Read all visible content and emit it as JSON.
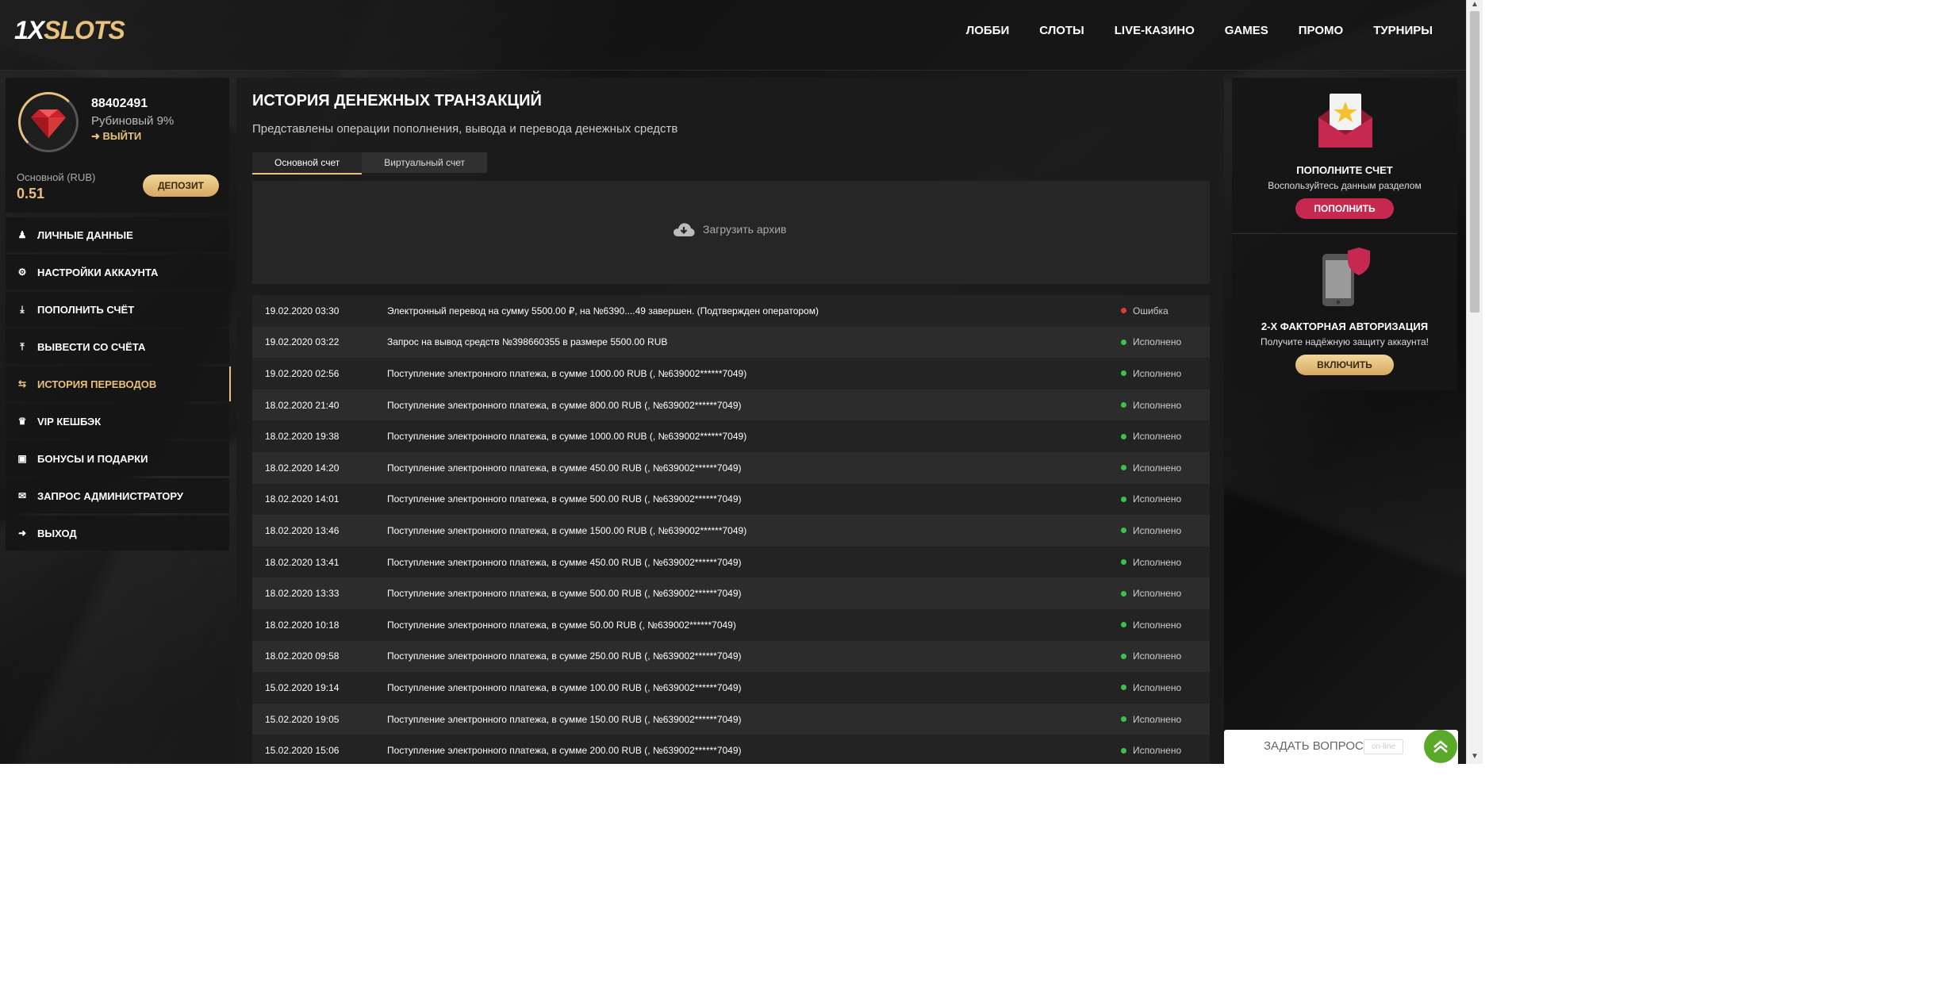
{
  "header": {
    "logo_main": "1X",
    "logo_accent": "SLOTS",
    "nav": [
      "ЛОББИ",
      "СЛОТЫ",
      "LIVE-КАЗИНО",
      "GAMES",
      "ПРОМО",
      "ТУРНИРЫ"
    ]
  },
  "profile": {
    "user_id": "88402491",
    "level": "Рубиновый 9%",
    "logout_label": "ВЫЙТИ",
    "balance_label": "Основной (RUB)",
    "balance_value": "0.51",
    "deposit_button": "ДЕПОЗИТ"
  },
  "sidebar": {
    "items": [
      {
        "label": "ЛИЧНЫЕ ДАННЫЕ",
        "icon": "user-plus-icon",
        "active": false
      },
      {
        "label": "НАСТРОЙКИ АККАУНТА",
        "icon": "gears-icon",
        "active": false
      },
      {
        "label": "ПОПОЛНИТЬ СЧЁТ",
        "icon": "download-icon",
        "active": false
      },
      {
        "label": "ВЫВЕСТИ СО СЧЁТА",
        "icon": "upload-icon",
        "active": false
      },
      {
        "label": "ИСТОРИЯ ПЕРЕВОДОВ",
        "icon": "transfer-arrows-icon",
        "active": true
      },
      {
        "label": "VIP КЕШБЭК",
        "icon": "crown-icon",
        "active": false
      },
      {
        "label": "БОНУСЫ И ПОДАРКИ",
        "icon": "gift-icon",
        "active": false
      },
      {
        "label": "ЗАПРОС АДМИНИСТРАТОРУ",
        "icon": "envelope-icon",
        "active": false
      },
      {
        "label": "ВЫХОД",
        "icon": "exit-icon",
        "active": false
      }
    ]
  },
  "main": {
    "title": "ИСТОРИЯ ДЕНЕЖНЫХ ТРАНЗАКЦИЙ",
    "subtitle": "Представлены операции пополнения, вывода и перевода денежных средств",
    "tabs": [
      {
        "label": "Основной счет",
        "active": true
      },
      {
        "label": "Виртуальный счет",
        "active": false
      }
    ],
    "archive_label": "Загрузить архив",
    "transactions": [
      {
        "date": "19.02.2020 03:30",
        "description": "Электронный перевод на сумму 5500.00 ₽, на №6390....49 завершен. (Подтвержден оператором)",
        "status": "Ошибка",
        "status_color": "#e03c3c"
      },
      {
        "date": "19.02.2020 03:22",
        "description": "Запрос на вывод средств №398660355 в размере 5500.00 RUB",
        "status": "Исполнено",
        "status_color": "#3cc24a"
      },
      {
        "date": "19.02.2020 02:56",
        "description": "Поступление электронного платежа, в сумме 1000.00 RUB (, №639002******7049)",
        "status": "Исполнено",
        "status_color": "#3cc24a"
      },
      {
        "date": "18.02.2020 21:40",
        "description": "Поступление электронного платежа, в сумме 800.00 RUB (, №639002******7049)",
        "status": "Исполнено",
        "status_color": "#3cc24a"
      },
      {
        "date": "18.02.2020 19:38",
        "description": "Поступление электронного платежа, в сумме 1000.00 RUB (, №639002******7049)",
        "status": "Исполнено",
        "status_color": "#3cc24a"
      },
      {
        "date": "18.02.2020 14:20",
        "description": "Поступление электронного платежа, в сумме 450.00 RUB (, №639002******7049)",
        "status": "Исполнено",
        "status_color": "#3cc24a"
      },
      {
        "date": "18.02.2020 14:01",
        "description": "Поступление электронного платежа, в сумме 500.00 RUB (, №639002******7049)",
        "status": "Исполнено",
        "status_color": "#3cc24a"
      },
      {
        "date": "18.02.2020 13:46",
        "description": "Поступление электронного платежа, в сумме 1500.00 RUB (, №639002******7049)",
        "status": "Исполнено",
        "status_color": "#3cc24a"
      },
      {
        "date": "18.02.2020 13:41",
        "description": "Поступление электронного платежа, в сумме 450.00 RUB (, №639002******7049)",
        "status": "Исполнено",
        "status_color": "#3cc24a"
      },
      {
        "date": "18.02.2020 13:33",
        "description": "Поступление электронного платежа, в сумме 500.00 RUB (, №639002******7049)",
        "status": "Исполнено",
        "status_color": "#3cc24a"
      },
      {
        "date": "18.02.2020 10:18",
        "description": "Поступление электронного платежа, в сумме 50.00 RUB (, №639002******7049)",
        "status": "Исполнено",
        "status_color": "#3cc24a"
      },
      {
        "date": "18.02.2020 09:58",
        "description": "Поступление электронного платежа, в сумме 250.00 RUB (, №639002******7049)",
        "status": "Исполнено",
        "status_color": "#3cc24a"
      },
      {
        "date": "15.02.2020 19:14",
        "description": "Поступление электронного платежа, в сумме 100.00 RUB (, №639002******7049)",
        "status": "Исполнено",
        "status_color": "#3cc24a"
      },
      {
        "date": "15.02.2020 19:05",
        "description": "Поступление электронного платежа, в сумме 150.00 RUB (, №639002******7049)",
        "status": "Исполнено",
        "status_color": "#3cc24a"
      },
      {
        "date": "15.02.2020 15:06",
        "description": "Поступление электронного платежа, в сумме 200.00 RUB (, №639002******7049)",
        "status": "Исполнено",
        "status_color": "#3cc24a"
      }
    ]
  },
  "promo": {
    "topup_title": "ПОПОЛНИТЕ СЧЕТ",
    "topup_text": "Воспользуйтесь данным разделом",
    "topup_button": "ПОПОЛНИТЬ",
    "twofa_title": "2-Х ФАКТОРНАЯ АВТОРИЗАЦИЯ",
    "twofa_text": "Получите надёжную защиту аккаунта!",
    "twofa_button": "ВКЛЮЧИТЬ"
  },
  "chat": {
    "label": "ЗАДАТЬ ВОПРОС",
    "badge": "on-line"
  },
  "colors": {
    "accent_gold": "#e7c17d",
    "accent_red": "#c7284f",
    "status_ok": "#3cc24a",
    "status_error": "#e03c3c"
  }
}
